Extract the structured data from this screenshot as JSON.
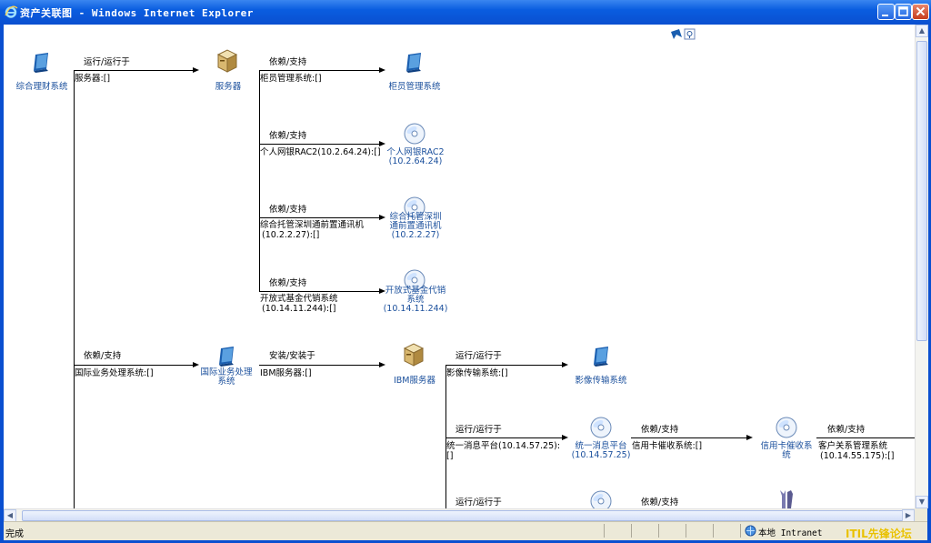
{
  "window": {
    "title": "资产关联图 - Windows Internet Explorer"
  },
  "status": {
    "text": "完成",
    "zone": "本地 Intranet"
  },
  "watermark": "ITIL先锋论坛",
  "nodes": {
    "n1": "综合理财系统",
    "n2": "服务器",
    "n3": "柜员管理系统",
    "n4": [
      "个人网银RAC2",
      "(10.2.64.24)"
    ],
    "n5": [
      "综合托管深圳",
      "通前置通讯机",
      "(10.2.2.27)"
    ],
    "n6": [
      "开放式基金代销",
      "系统",
      "(10.14.11.244)"
    ],
    "n7": [
      "国际业务处理",
      "系统"
    ],
    "n8": "IBM服务器",
    "n9": "影像传输系统",
    "n10": [
      "统一消息平台",
      "(10.14.57.25)"
    ],
    "n11": [
      "信用卡催收系",
      "统"
    ]
  },
  "edges": {
    "e1_rel": "运行/运行于",
    "e1_tgt": "服务器:[]",
    "e2_rel": "依赖/支持",
    "e2_tgt": "柜员管理系统:[]",
    "e3_rel": "依赖/支持",
    "e3_tgt": "个人网银RAC2(10.2.64.24):[]",
    "e4_rel": "依赖/支持",
    "e4_tgt": [
      "综合托管深圳通前置通讯机",
      "(10.2.2.27):[]"
    ],
    "e5_rel": "依赖/支持",
    "e5_tgt": [
      "开放式基金代销系统",
      "(10.14.11.244):[]"
    ],
    "e6_rel": "依赖/支持",
    "e6_tgt": "国际业务处理系统:[]",
    "e7_rel": "安装/安装于",
    "e7_tgt": "IBM服务器:[]",
    "e8_rel": "运行/运行于",
    "e8_tgt": "影像传输系统:[]",
    "e9_rel": "运行/运行于",
    "e9_tgt": [
      "统一消息平台(10.14.57.25):",
      "[]"
    ],
    "e10_rel": "依赖/支持",
    "e10_tgt": "信用卡催收系统:[]",
    "e11_rel": "依赖/支持",
    "e11_tgt": [
      "客户关系管理系统",
      "(10.14.55.175):[]"
    ],
    "e12_rel": "运行/运行于",
    "e13_rel": "依赖/支持"
  },
  "icons": {
    "app": "application-book-icon",
    "server": "server-box-icon",
    "disc": "cd-disc-icon",
    "tool": "tool-icon"
  },
  "colors": {
    "title_bar": "#0a5de0",
    "node_text": "#1a4f9c",
    "watermark": "#e8c000"
  }
}
